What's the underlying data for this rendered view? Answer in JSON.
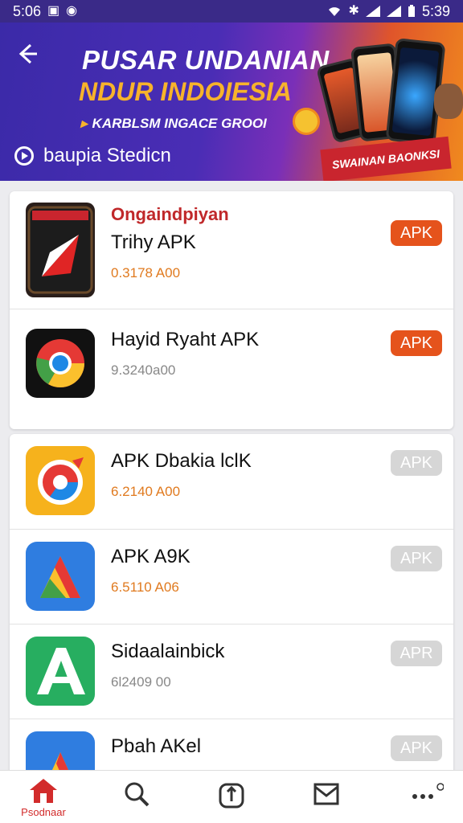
{
  "status_bar": {
    "time_left": "5:06",
    "time_right": "5:39"
  },
  "banner": {
    "title_line1": "PUSAR UNDANIAN",
    "title_line2": "NDUR INDOIESIA",
    "title_line3": "KARBLSM INGACE GROOI",
    "play_label": "baupia Stedicn",
    "ribbon_label": "SWAINAN BAONKSI"
  },
  "apps": [
    {
      "category": "Ongaindpiyan",
      "name": "Trihy APK",
      "size": "0.3178 A00",
      "button": "APK",
      "state": "active"
    },
    {
      "category": "",
      "name": "Hayid Ryaht APK",
      "size": "9.3240a00",
      "button": "APK",
      "state": "active"
    },
    {
      "category": "",
      "name": "APK Dbakia lclK",
      "size": "6.2140 A00",
      "button": "APK",
      "state": "muted"
    },
    {
      "category": "",
      "name": "APK A9K",
      "size": "6.5110 A06",
      "button": "APK",
      "state": "muted"
    },
    {
      "category": "",
      "name": "Sidaalainbick",
      "size": "6l2409 00",
      "button": "APR",
      "state": "muted"
    },
    {
      "category": "",
      "name": "Pbah AKel",
      "size": "",
      "button": "APK",
      "state": "muted"
    }
  ],
  "bottom_nav": {
    "items": [
      {
        "label": "Psodnaar",
        "icon": "home-icon"
      },
      {
        "label": "",
        "icon": "search-icon"
      },
      {
        "label": "",
        "icon": "download-icon"
      },
      {
        "label": "",
        "icon": "mail-icon"
      },
      {
        "label": "",
        "icon": "more-icon"
      }
    ]
  },
  "colors": {
    "accent": "#e5531c",
    "brand": "#3b2aa8",
    "muted": "#d6d6d6"
  }
}
